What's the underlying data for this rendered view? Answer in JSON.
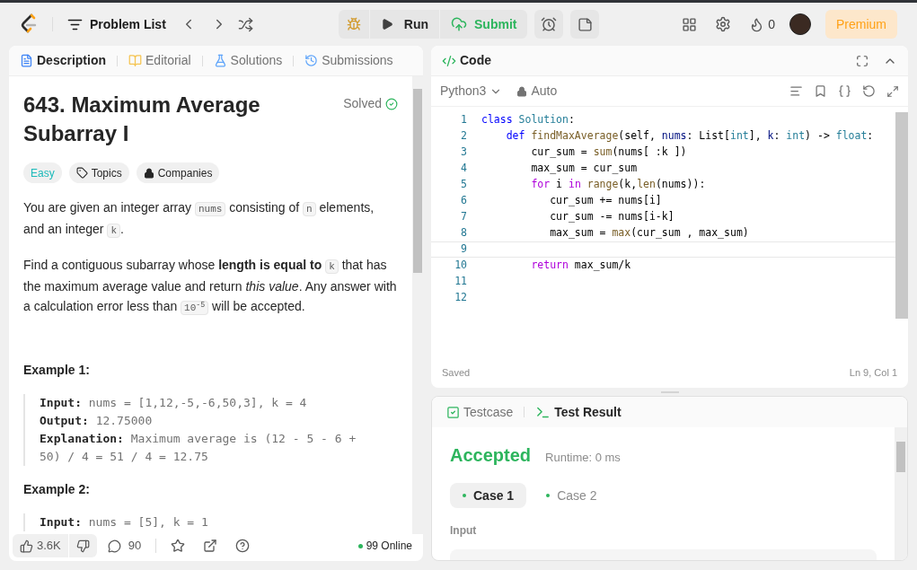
{
  "nav": {
    "problem_list": "Problem List",
    "run": "Run",
    "submit": "Submit",
    "streak": "0",
    "premium": "Premium"
  },
  "left_tabs": [
    {
      "label": "Description",
      "selected": true
    },
    {
      "label": "Editorial",
      "selected": false
    },
    {
      "label": "Solutions",
      "selected": false
    },
    {
      "label": "Submissions",
      "selected": false
    }
  ],
  "problem": {
    "title": "643. Maximum Average Subarray I",
    "status": "Solved",
    "difficulty": "Easy",
    "tags": [
      "Topics",
      "Companies"
    ],
    "paragraphs": [
      [
        {
          "kind": "text",
          "text": "You are given an integer array "
        },
        {
          "kind": "code",
          "text": "nums"
        },
        {
          "kind": "text",
          "text": " consisting of "
        },
        {
          "kind": "code",
          "text": "n"
        },
        {
          "kind": "text",
          "text": " elements, and an integer "
        },
        {
          "kind": "code",
          "text": "k"
        },
        {
          "kind": "text",
          "text": "."
        }
      ],
      [
        {
          "kind": "text",
          "text": "Find a contiguous subarray whose **length is equal to** "
        },
        {
          "kind": "code",
          "text": "k"
        },
        {
          "kind": "text",
          "text": " that has the maximum average value and return *this value*. Any answer with a calculation error less than "
        },
        {
          "kind": "code",
          "text": "10$^{-5}$"
        },
        {
          "kind": "text",
          "text": " will be accepted."
        }
      ]
    ],
    "examples": [
      {
        "title": "Example 1:",
        "lines": [
          {
            "label": "Input:",
            "text": "nums = [1,12,-5,-6,50,3], k = 4"
          },
          {
            "label": "Output:",
            "text": "12.75000"
          },
          {
            "label": "Explanation:",
            "text": "Maximum average is (12 - 5 - 6 + 50) / 4 = 51 / 4 = 12.75"
          }
        ]
      },
      {
        "title": "Example 2:",
        "lines": [
          {
            "label": "Input:",
            "text": "nums = [5], k = 1"
          }
        ]
      }
    ]
  },
  "footer": {
    "likes": "3.6K",
    "comments": "90",
    "online": "99 Online"
  },
  "code_panel": {
    "title": "Code",
    "language": "Python3",
    "mode": "Auto",
    "saved": "Saved",
    "cursor": "Ln 9, Col 1",
    "lines": [
      {
        "number": "1",
        "current": false,
        "tokens": [
          {
            "kind": "keyword",
            "text": "class "
          },
          {
            "kind": "type",
            "text": "Solution"
          },
          {
            "kind": "plain",
            "text": ":"
          }
        ]
      },
      {
        "number": "2",
        "current": false,
        "tokens": [
          {
            "kind": "keyword",
            "text": "    def "
          },
          {
            "kind": "function",
            "text": "findMaxAverage"
          },
          {
            "kind": "plain",
            "text": "(self, "
          },
          {
            "kind": "param",
            "text": "nums"
          },
          {
            "kind": "plain",
            "text": ": List["
          },
          {
            "kind": "type",
            "text": "int"
          },
          {
            "kind": "plain",
            "text": "], "
          },
          {
            "kind": "param",
            "text": "k"
          },
          {
            "kind": "plain",
            "text": ": "
          },
          {
            "kind": "type",
            "text": "int"
          },
          {
            "kind": "plain",
            "text": ") -> "
          },
          {
            "kind": "type",
            "text": "float"
          },
          {
            "kind": "plain",
            "text": ":"
          }
        ]
      },
      {
        "number": "3",
        "current": false,
        "tokens": [
          {
            "kind": "plain",
            "text": "        cur_sum = "
          },
          {
            "kind": "function",
            "text": "sum"
          },
          {
            "kind": "plain",
            "text": "(nums[ :k ])"
          }
        ]
      },
      {
        "number": "4",
        "current": false,
        "tokens": [
          {
            "kind": "plain",
            "text": "        max_sum = cur_sum"
          }
        ]
      },
      {
        "number": "5",
        "current": false,
        "tokens": [
          {
            "kind": "control",
            "text": "        for"
          },
          {
            "kind": "plain",
            "text": " i "
          },
          {
            "kind": "control",
            "text": "in"
          },
          {
            "kind": "function",
            "text": " range"
          },
          {
            "kind": "plain",
            "text": "(k,"
          },
          {
            "kind": "function",
            "text": "len"
          },
          {
            "kind": "plain",
            "text": "(nums)):"
          }
        ]
      },
      {
        "number": "6",
        "current": false,
        "tokens": [
          {
            "kind": "plain",
            "text": "           cur_sum += nums[i]"
          }
        ]
      },
      {
        "number": "7",
        "current": false,
        "tokens": [
          {
            "kind": "plain",
            "text": "           cur_sum -= nums[i-k]"
          }
        ]
      },
      {
        "number": "8",
        "current": false,
        "tokens": [
          {
            "kind": "plain",
            "text": "           max_sum = "
          },
          {
            "kind": "function",
            "text": "max"
          },
          {
            "kind": "plain",
            "text": "(cur_sum , max_sum)"
          }
        ]
      },
      {
        "number": "9",
        "current": true
      },
      {
        "number": "10",
        "current": false,
        "tokens": [
          {
            "kind": "control",
            "text": "        return"
          },
          {
            "kind": "plain",
            "text": " max_sum/k"
          }
        ]
      },
      {
        "number": "11",
        "current": false
      },
      {
        "number": "12",
        "current": false
      }
    ]
  },
  "result_tabs": [
    {
      "label": "Testcase",
      "selected": false
    },
    {
      "label": "Test Result",
      "selected": true
    }
  ],
  "result": {
    "verdict": "Accepted",
    "runtime": "Runtime: 0 ms",
    "cases": [
      {
        "label": "Case 1",
        "selected": true
      },
      {
        "label": "Case 2",
        "selected": false
      }
    ],
    "input_label": "Input"
  }
}
